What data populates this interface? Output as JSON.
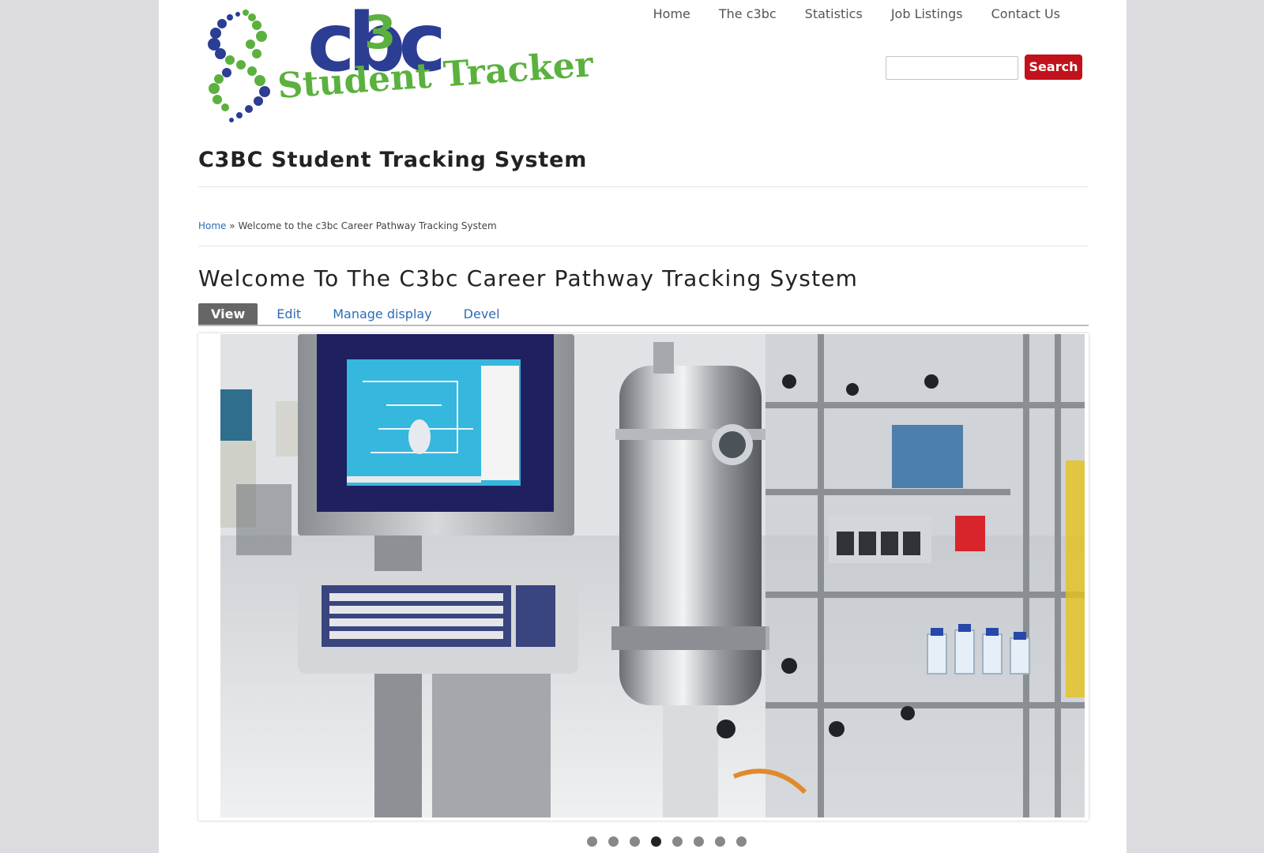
{
  "logo": {
    "wordmark": "c3bc",
    "wordmark_base": "cbc",
    "wordmark_superscript": "3",
    "tagline": "Student Tracker",
    "colors": {
      "blue": "#2c3d94",
      "green": "#5bb13e"
    }
  },
  "nav": {
    "items": [
      {
        "label": "Home"
      },
      {
        "label": "The c3bc"
      },
      {
        "label": "Statistics"
      },
      {
        "label": "Job Listings"
      },
      {
        "label": "Contact Us"
      }
    ]
  },
  "search": {
    "value": "",
    "button_label": "Search",
    "button_color": "#c1121b"
  },
  "site_name": "C3BC Student Tracking System",
  "breadcrumb": {
    "home": "Home",
    "separator": "»",
    "current": "Welcome to the c3bc Career Pathway Tracking System"
  },
  "page_title": "Welcome To The C3bc Career Pathway Tracking System",
  "tabs": [
    {
      "label": "View",
      "active": true
    },
    {
      "label": "Edit",
      "active": false
    },
    {
      "label": "Manage display",
      "active": false
    },
    {
      "label": "Devel",
      "active": false
    }
  ],
  "slideshow": {
    "image_subject": "stainless steel bioreactor with control monitor and keyboard in a laboratory",
    "slide_count": 8,
    "current_slide": 4
  },
  "colors": {
    "page_bg": "#dcdce0",
    "link": "#2d6db5",
    "active_tab": "#666666"
  }
}
